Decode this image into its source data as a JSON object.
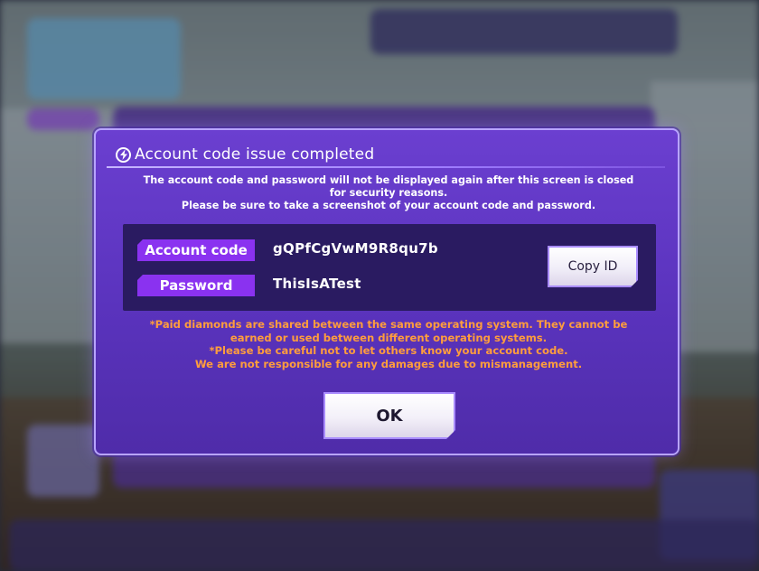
{
  "dialog": {
    "title": "Account code issue completed",
    "title_icon": "lightning-icon",
    "notice_lines": [
      "The account code and password will not be displayed again after this screen is closed",
      "for security reasons.",
      "Please be sure to take a screenshot of your account code and password."
    ],
    "account_code_label": "Account code",
    "account_code_value": "gQPfCgVwM9R8qu7b",
    "password_label": "Password",
    "password_value": "ThisIsATest",
    "copy_button": "Copy ID",
    "warning_lines": [
      "*Paid diamonds are shared between the same operating system. They cannot be",
      "earned or used between different operating systems.",
      "*Please be careful not to let others know your account code.",
      "We are not responsible for any damages due to mismanagement."
    ],
    "ok_button": "OK"
  },
  "colors": {
    "dialog_bg": "#5a33bd",
    "panel_bg": "#2a1b61",
    "label_bg": "#8a32f0",
    "warning_text": "#ff9d3d",
    "border": "#b8a4ff"
  }
}
